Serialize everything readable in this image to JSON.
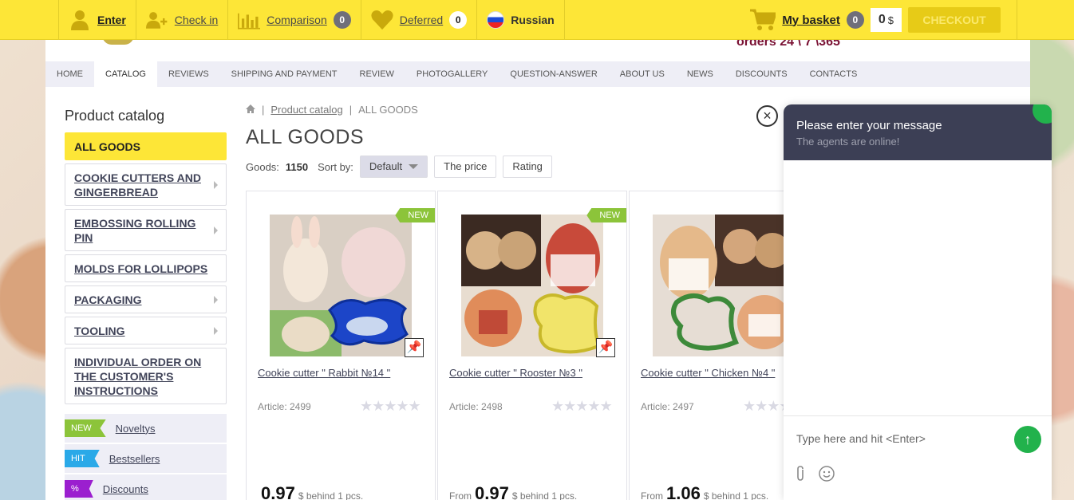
{
  "topbar": {
    "enter": "Enter",
    "checkin": "Check in",
    "comparison": "Comparison",
    "comparison_count": "0",
    "deferred": "Deferred",
    "deferred_count": "0",
    "language": "Russian",
    "basket": "My basket",
    "basket_count": "0",
    "sum": "0",
    "currency": "$",
    "checkout": "CHECKOUT"
  },
  "orders_text": "orders 24 \\ 7 \\365",
  "nav": [
    "HOME",
    "CATALOG",
    "REVIEWS",
    "SHIPPING AND PAYMENT",
    "REVIEW",
    "PHOTOGALLERY",
    "QUESTION-ANSWER",
    "ABOUT US",
    "NEWS",
    "DISCOUNTS",
    "CONTACTS"
  ],
  "sidebar": {
    "title": "Product catalog",
    "categories": [
      {
        "label": "ALL GOODS",
        "active": true
      },
      {
        "label": "COOKIE CUTTERS AND GINGERBREAD"
      },
      {
        "label": "EMBOSSING ROLLING PIN"
      },
      {
        "label": "MOLDS FOR LOLLIPOPS"
      },
      {
        "label": "PACKAGING"
      },
      {
        "label": "TOOLING"
      },
      {
        "label": "INDIVIDUAL ORDER ON THE CUSTOMER'S INSTRUCTIONS"
      }
    ],
    "tags": [
      {
        "tag": "NEW",
        "label": "Noveltys",
        "color": "#8cc43a"
      },
      {
        "tag": "HIT",
        "label": "Bestsellers",
        "color": "#2aa9e8"
      },
      {
        "tag": "%",
        "label": "Discounts",
        "color": "#9b1fcf"
      }
    ]
  },
  "breadcrumb": {
    "catalog": "Product catalog",
    "current": "ALL GOODS"
  },
  "page_title": "ALL GOODS",
  "sort": {
    "goods_label": "Goods:",
    "goods_count": "1150",
    "sort_label": "Sort by:",
    "options": [
      "Default",
      "The price",
      "Rating"
    ]
  },
  "products": [
    {
      "name": "Cookie cutter \" Rabbit №14 \"",
      "article": "Article: 2499",
      "new": "NEW",
      "prefix": "",
      "price": "0.97",
      "unit": "$ behind 1 pcs."
    },
    {
      "name": "Cookie cutter \" Rooster №3 \"",
      "article": "Article: 2498",
      "new": "NEW",
      "prefix": "From",
      "price": "0.97",
      "unit": "$ behind 1 pcs."
    },
    {
      "name": "Cookie cutter \" Chicken №4 \"",
      "article": "Article: 2497",
      "new": "",
      "prefix": "From",
      "price": "1.06",
      "unit": "$ behind 1 pcs."
    }
  ],
  "chat": {
    "title": "Please enter your message",
    "subtitle": "The agents are online!",
    "placeholder": "Type here and hit <Enter>"
  }
}
